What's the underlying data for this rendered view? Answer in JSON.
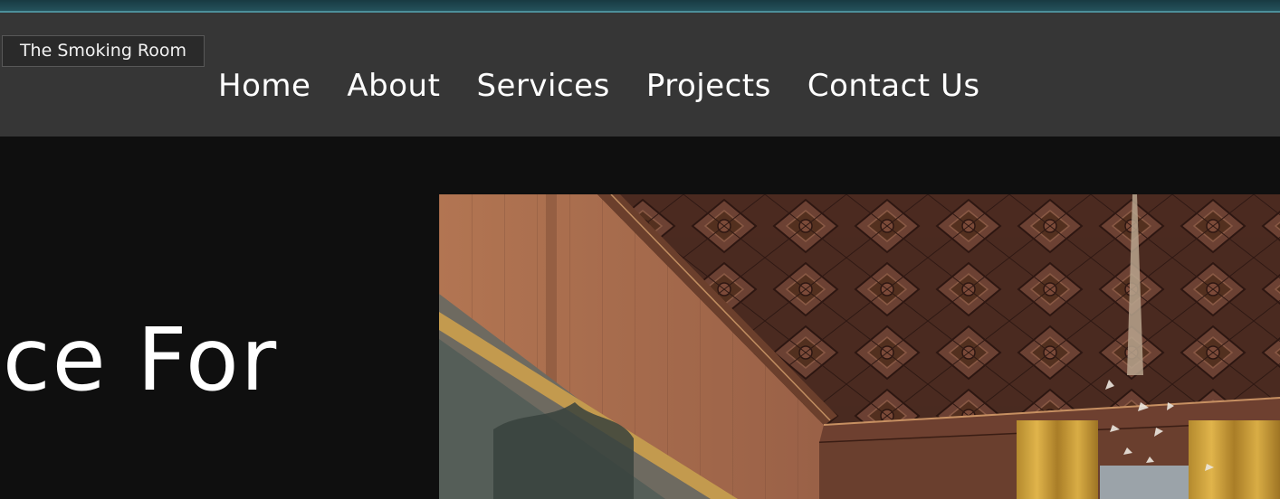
{
  "tooltip": {
    "text": "The Smoking Room"
  },
  "nav": {
    "items": [
      {
        "label": "Home"
      },
      {
        "label": "About"
      },
      {
        "label": "Services"
      },
      {
        "label": "Projects"
      },
      {
        "label": "Contact Us"
      }
    ]
  },
  "hero": {
    "heading_visible": "ace For",
    "image_subject": "ornate wood-paneled smoking room with coffered ceiling and gold curtains"
  },
  "colors": {
    "navbar": "#363636",
    "page_background": "#0f0f0f",
    "top_strip": "#24525c",
    "nav_text": "#ffffff"
  }
}
